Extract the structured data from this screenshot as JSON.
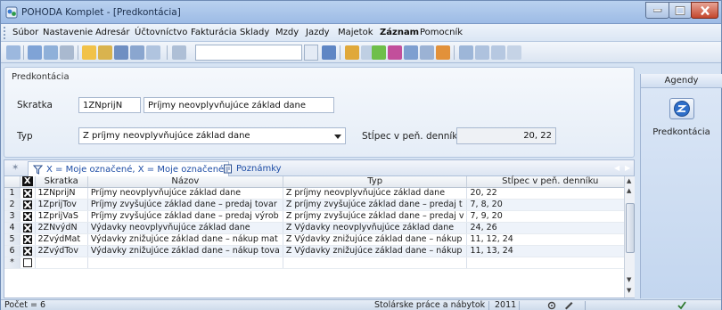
{
  "window": {
    "title": "POHODA Komplet - [Predkontácia]"
  },
  "menu": [
    "Súbor",
    "Nastavenie",
    "Adresár",
    "Účtovníctvo",
    "Fakturácia",
    "Sklady",
    "Mzdy",
    "Jazdy",
    "Majetok",
    "Záznam",
    "Pomocník"
  ],
  "form": {
    "legend": "Predkontácia",
    "skratka_label": "Skratka",
    "skratka_value": "1ZNprijN",
    "nazov_value": "Príjmy neovplyvňujúce základ dane",
    "typ_label": "Typ",
    "typ_value": "Z príjmy neovplyvňujúce základ dane",
    "stlpec_label": "Stĺpec v peň. denníku",
    "stlpec_value": "20, 22"
  },
  "tabs": [
    {
      "label": "X = Moje označené, X = Moje označené"
    },
    {
      "label": "Poznámky"
    }
  ],
  "grid": {
    "columns": [
      "X",
      "Skratka",
      "Názov",
      "Typ",
      "Stĺpec v peň. denníku"
    ],
    "rows": [
      {
        "n": "1",
        "checked": true,
        "skratka": "1ZNprijN",
        "nazov": "Príjmy neovplyvňujúce základ dane",
        "typ": "Z príjmy neovplyvňujúce základ dane",
        "stlpec": "20, 22"
      },
      {
        "n": "2",
        "checked": true,
        "skratka": "1ZprijTov",
        "nazov": "Príjmy zvyšujúce základ dane – predaj tovar",
        "typ": "Z príjmy zvyšujúce základ dane – predaj t",
        "stlpec": "7, 8, 20"
      },
      {
        "n": "3",
        "checked": true,
        "skratka": "1ZprijVaS",
        "nazov": "Príjmy zvyšujúce základ dane – predaj výrob",
        "typ": "Z príjmy zvyšujúce základ dane – predaj v",
        "stlpec": "7, 9, 20"
      },
      {
        "n": "4",
        "checked": true,
        "skratka": "2ZNvýdN",
        "nazov": "Výdavky neovplyvňujúce základ dane",
        "typ": "Z Výdavky neovplyvňujúce základ dane",
        "stlpec": "24, 26"
      },
      {
        "n": "5",
        "checked": true,
        "skratka": "2ZvýdMat",
        "nazov": "Výdavky znižujúce základ dane – nákup mat",
        "typ": "Z Výdavky znižujúce základ dane – nákup",
        "stlpec": "11, 12, 24"
      },
      {
        "n": "6",
        "checked": true,
        "skratka": "2ZvýdTov",
        "nazov": "Výdavky znižujúce základ dane – nákup tova",
        "typ": "Z Výdavky znižujúce základ dane – nákup",
        "stlpec": "11, 13, 24"
      },
      {
        "n": "*",
        "checked": false,
        "skratka": "",
        "nazov": "",
        "typ": "",
        "stlpec": ""
      }
    ]
  },
  "agendy": {
    "header": "Agendy",
    "item": "Predkontácia"
  },
  "status": {
    "count": "Počet = 6",
    "company": "Stolárske práce a nábytok",
    "year": "2011"
  },
  "colors": {
    "accent": "#1e4da5",
    "titlebar": "#b9d1ef",
    "close": "#c4472c"
  }
}
